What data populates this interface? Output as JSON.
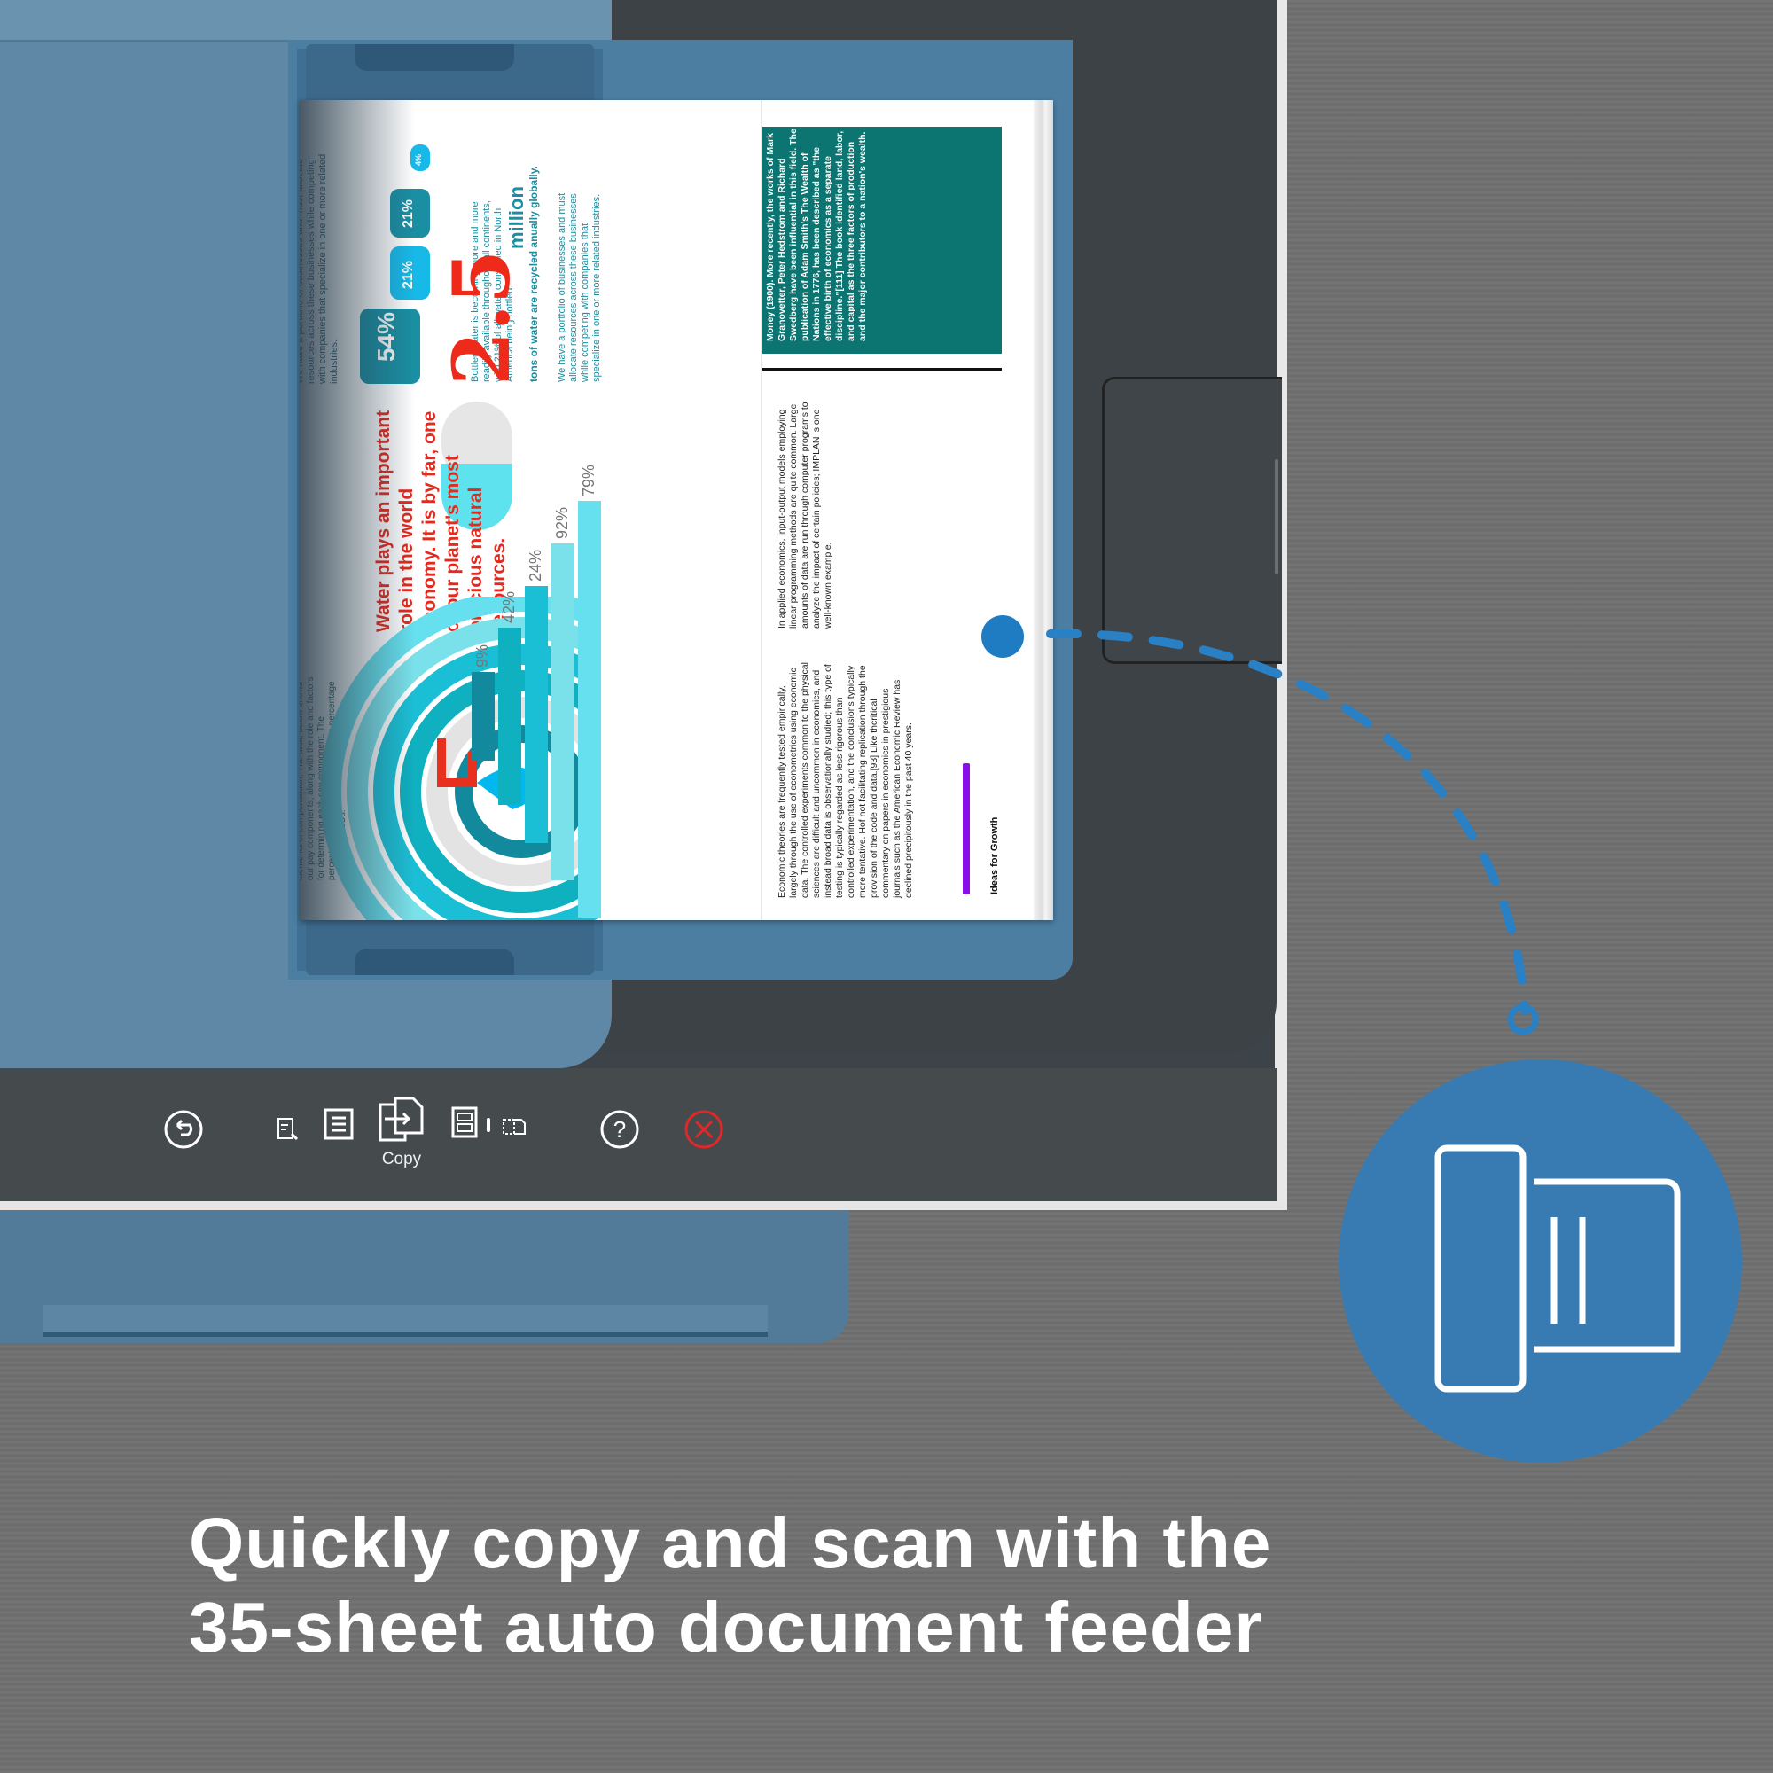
{
  "headline": {
    "line1": "Quickly copy and scan with the",
    "line2": "35-sheet auto document feeder"
  },
  "control_panel": {
    "buttons": [
      {
        "icon": "back-icon",
        "label": ""
      },
      {
        "icon": "copy-settings-icon",
        "label": ""
      },
      {
        "icon": "document-icon",
        "label": ""
      },
      {
        "icon": "copy-icon",
        "label": "Copy"
      },
      {
        "icon": "id-card-copy-icon",
        "label": ""
      },
      {
        "icon": "duplex-icon",
        "label": ""
      },
      {
        "icon": "help-icon",
        "label": ""
      },
      {
        "icon": "cancel-icon",
        "label": ""
      }
    ],
    "active_label": "Copy",
    "cancel_color": "#e02828"
  },
  "callout": {
    "icon": "adf-scanner-icon",
    "color": "#387bb2"
  },
  "document": {
    "left_page": {
      "intro_text": "We have a portfolio of businesses and must allocate resources across these businesses while competing with companies that specialize in one or more related industries.",
      "bottles": [
        {
          "value": "54%",
          "color": "#1a8fa3"
        },
        {
          "value": "21%",
          "color": "#17b9e8"
        },
        {
          "value": "21%",
          "color": "#1a8fa3"
        },
        {
          "value": "4%",
          "color": "#17b9e8"
        }
      ],
      "bottle_caption": "Bottled water is becoming more and more readily available throughout all continents, with 21% of all water consumed in North America being bottled.",
      "big_number": "2.5",
      "big_unit": "million",
      "big_caption": "tons of water are recycled anually globally.",
      "big_body": "We have a portfolio of businesses and must allocate resources across these businesses while competing with companies that specialize in one or more related industries.",
      "headline": "Water plays an important role in the world economy. It is by far, one of our planet's most precious natural resources.",
      "footnote": "elements of compensation. The table below shows our pay components, along with the role and factors for determining each pay component. The percentages are based on the average percentage among the NEOs.",
      "bars": [
        "9%",
        "42%",
        "24%",
        "92%",
        "79%"
      ]
    },
    "right_page": {
      "teal_box_text": "Money (1900). More recently, the works of Mark Granovetter, Peter Hedstrom and Richard Swedberg have been influential in this field. The publication of Adam Smith's The Wealth of Nations in 1776, has been described as \"the effective birth of economics as a separate discipline.\"[111] The book identified land, labor, and capital as the three factors of production and the major contributors to a nation's wealth.",
      "para1": "In applied economics, input-output models employing linear programming methods are quite common. Large amounts of data are run through computer programs to analyze the impact of certain policies; IMPLAN is one well-known example.",
      "para2": "Economic theories are frequently tested empirically, largely through the use of econometrics using economic data. The controlled experiments common to the physical sciences are difficult and uncommon in economics, and instead broad data is observationally studied; this type of testing is typically regarded as less rigorous than controlled experimentation, and the conclusions typically more tentative. Hof not facilitating replication through the provision of the code and data.[93] Like thcritical commentary on papers in economics in prestigious journals such as the American Economic Review has declined precipitously in the past 40 years.",
      "section_title": "Ideas for Growth"
    }
  }
}
